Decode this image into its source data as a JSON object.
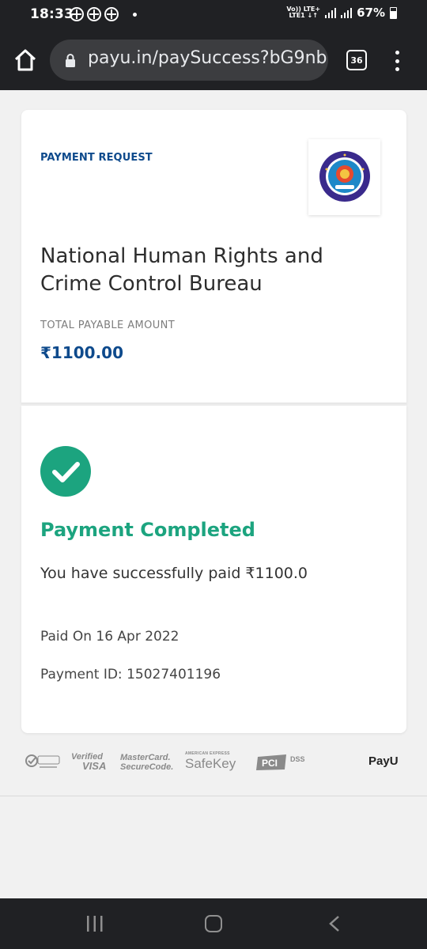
{
  "status_bar": {
    "time": "18:33",
    "network_top": "Vo)) LTE+",
    "network_bottom": "LTE1 ↓↑",
    "battery": "67%"
  },
  "browser": {
    "url": "payu.in/paySuccess?bG9nb",
    "tab_count": "36"
  },
  "payment_request": {
    "label": "PAYMENT REQUEST",
    "merchant_name": "National Human Rights and Crime Control Bureau",
    "total_label": "TOTAL PAYABLE AMOUNT",
    "amount": "₹1100.00"
  },
  "payment_status": {
    "title": "Payment Completed",
    "message": "You have successfully paid ₹1100.0",
    "paid_on": "Paid On 16 Apr 2022",
    "payment_id": "Payment ID: 15027401196"
  },
  "trust_logos": {
    "visa_top": "Verified",
    "visa_bottom": "VISA",
    "mastercard_top": "MasterCard.",
    "mastercard_bottom": "SecureCode.",
    "amex_small": "AMERICAN EXPRESS",
    "safekey": "SafeKey",
    "pci_dss": "DSS",
    "payu": "PayU"
  },
  "colors": {
    "brand_blue": "#0e4a8c",
    "success_green": "#1ca47f",
    "chrome_dark": "#202124"
  },
  "icons": {
    "home": "home-icon",
    "lock": "lock-icon",
    "tabs": "tab-switcher-icon",
    "menu": "more-vert-icon",
    "success": "check-circle-icon"
  }
}
